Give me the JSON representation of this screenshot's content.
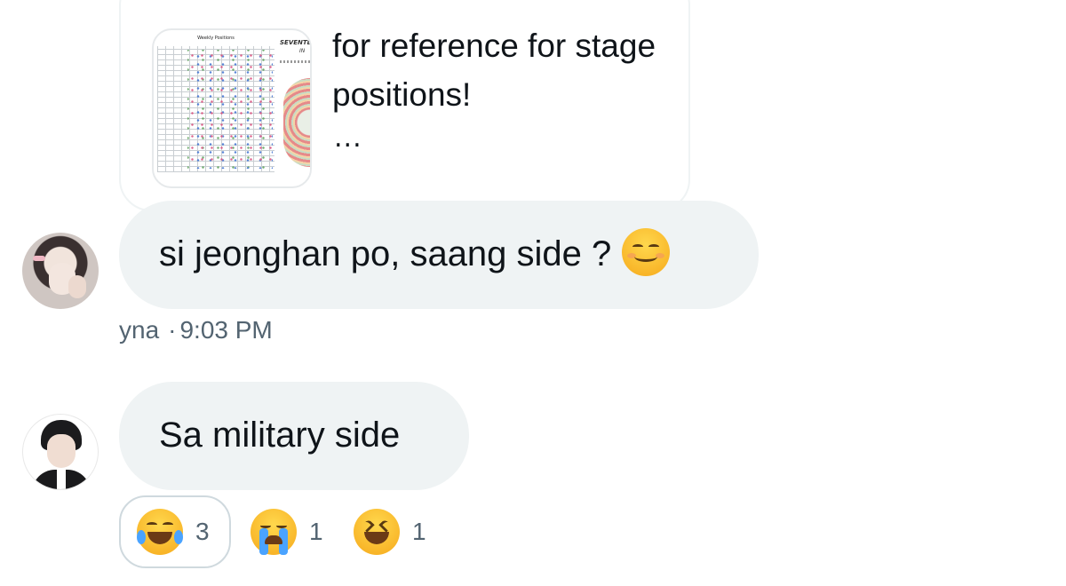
{
  "quoted_card": {
    "thumbnail_header": "Weekly Positions",
    "thumbnail_side_title": "SEVENTE",
    "thumbnail_side_sub": "IN",
    "text": "for reference for stage positions!",
    "more": "..."
  },
  "messages": [
    {
      "text": "si jeonghan po, saang side ?",
      "emoji": "smiling-face-with-smiling-eyes",
      "sender": "yna",
      "separator": "·",
      "time": "9:03 PM"
    },
    {
      "text": "Sa military side",
      "reactions": [
        {
          "emoji": "face-with-tears-of-joy",
          "count": "3",
          "selected": true
        },
        {
          "emoji": "loudly-crying-face",
          "count": "1",
          "selected": false
        },
        {
          "emoji": "grinning-squinting-face",
          "count": "1",
          "selected": false
        }
      ]
    }
  ]
}
